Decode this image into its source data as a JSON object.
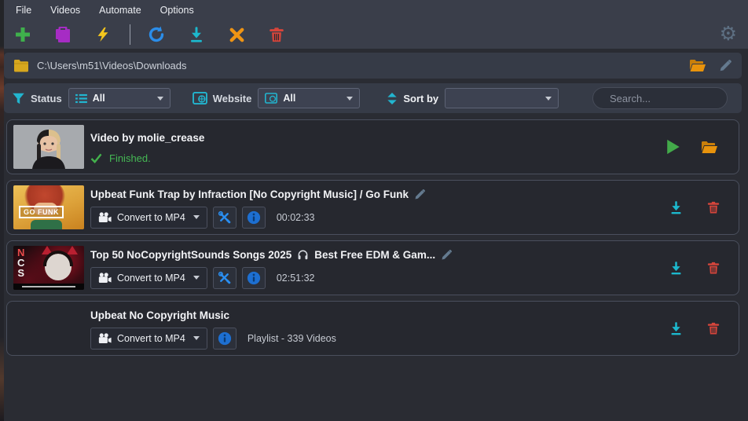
{
  "menubar": {
    "items": [
      "File",
      "Videos",
      "Automate",
      "Options"
    ]
  },
  "toolbar": {
    "icons": [
      "add-icon",
      "paste-icon",
      "lightning-icon",
      "refresh-icon",
      "download-all-icon",
      "cancel-all-icon",
      "delete-all-icon",
      "gear-icon"
    ],
    "gear_glyph": "⚙"
  },
  "pathbar": {
    "path": "C:\\Users\\m51\\Videos\\Downloads"
  },
  "filterbar": {
    "status_label": "Status",
    "status_value": "All",
    "website_label": "Website",
    "website_value": "All",
    "sort_label": "Sort by",
    "sort_value": "",
    "search_placeholder": "Search..."
  },
  "rows": [
    {
      "title": "Video by molie_crease",
      "status": "Finished.",
      "thumb": "portrait-girl-split-hair"
    },
    {
      "title": "Upbeat Funk Trap by Infraction [No Copyright Music] / Go Funk",
      "convert_label": "Convert to MP4",
      "duration": "00:02:33",
      "thumb_label": "GO FUNK"
    },
    {
      "title_pre": "Top 50 NoCopyrightSounds Songs 2025",
      "title_post": "Best Free EDM & Gam...",
      "convert_label": "Convert to MP4",
      "duration": "02:51:32",
      "thumb_letter_n": "N",
      "thumb_letter_c": "C",
      "thumb_letter_s": "S"
    },
    {
      "title": "Upbeat No Copyright Music",
      "convert_label": "Convert to MP4",
      "meta": "Playlist - 339 Videos"
    }
  ],
  "colors": {
    "topbar_bg": "#3a3e4a",
    "bar_bg": "#363b47",
    "page_bg": "#2a2c33",
    "card_bg": "#26282f",
    "accent_teal": "#22b5cf",
    "green": "#43b14c",
    "yellow": "#f4c61d",
    "purple": "#a62cc4",
    "blue": "#2b8de9",
    "orange": "#ef9414",
    "red": "#d6453b",
    "gold_folder": "#d7a71e",
    "open_folder": "#e8930c",
    "info_blue": "#1d6fd1"
  }
}
